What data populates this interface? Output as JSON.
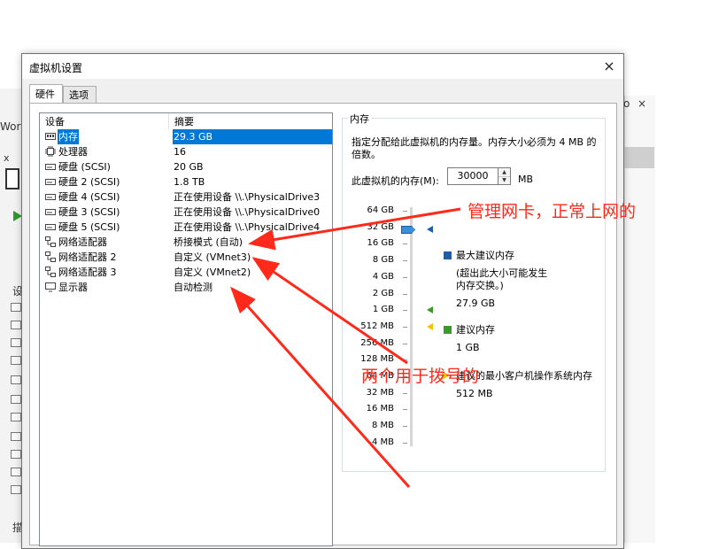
{
  "background": {
    "partial_text_1": "Work",
    "partial_text_2": "x",
    "partial_text_3": "设",
    "partial_text_4": "描",
    "close_label": "×",
    "partial_right": "o"
  },
  "dialog": {
    "title": "虚拟机设置",
    "close_label": "×",
    "tabs": [
      {
        "label": "硬件"
      },
      {
        "label": "选项"
      }
    ]
  },
  "device_list": {
    "headers": {
      "device": "设备",
      "summary": "摘要"
    },
    "rows": [
      {
        "icon": "memory-icon",
        "name": "内存",
        "summary": "29.3 GB",
        "selected": true
      },
      {
        "icon": "processor-icon",
        "name": "处理器",
        "summary": "16"
      },
      {
        "icon": "hard-disk-icon",
        "name": "硬盘 (SCSI)",
        "summary": "20 GB"
      },
      {
        "icon": "hard-disk-icon",
        "name": "硬盘 2 (SCSI)",
        "summary": "1.8 TB"
      },
      {
        "icon": "hard-disk-icon",
        "name": "硬盘 4 (SCSI)",
        "summary": "正在使用设备 \\\\.\\PhysicalDrive3"
      },
      {
        "icon": "hard-disk-icon",
        "name": "硬盘 3 (SCSI)",
        "summary": "正在使用设备 \\\\.\\PhysicalDrive0"
      },
      {
        "icon": "hard-disk-icon",
        "name": "硬盘 5 (SCSI)",
        "summary": "正在使用设备 \\\\.\\PhysicalDrive4"
      },
      {
        "icon": "network-adapter-icon",
        "name": "网络适配器",
        "summary": "桥接模式 (自动)"
      },
      {
        "icon": "network-adapter-icon",
        "name": "网络适配器 2",
        "summary": "自定义 (VMnet3)"
      },
      {
        "icon": "network-adapter-icon",
        "name": "网络适配器 3",
        "summary": "自定义 (VMnet2)"
      },
      {
        "icon": "display-icon",
        "name": "显示器",
        "summary": "自动检测"
      }
    ]
  },
  "memory": {
    "group_title": "内存",
    "description": "指定分配给此虚拟机的内存量。内存大小必须为 4 MB 的倍数。",
    "input_label": "此虚拟机的内存(M):",
    "value": "30000",
    "unit": "MB",
    "scale_labels": [
      "64 GB",
      "32 GB",
      "16 GB",
      "8 GB",
      "4 GB",
      "2 GB",
      "1 GB",
      "512 MB",
      "256 MB",
      "128 MB",
      "64 MB",
      "32 MB",
      "16 MB",
      "8 MB",
      "4 MB"
    ],
    "legend": {
      "max_title": "最大建议内存",
      "max_note": "(超出此大小可能发生内存交换。)",
      "max_value": "27.9 GB",
      "rec_title": "建议内存",
      "rec_value": "1 GB",
      "min_title": "建议的最小客户机操作系统内存",
      "min_value": "512 MB"
    },
    "colors": {
      "max": "#1c5fa8",
      "recommended": "#3c9a2c",
      "minimum": "#f0c400"
    }
  },
  "annotations": {
    "text_1": "管理网卡，正常上网的",
    "text_2": "两个用于拨号的",
    "color": "#ff2a1a"
  }
}
